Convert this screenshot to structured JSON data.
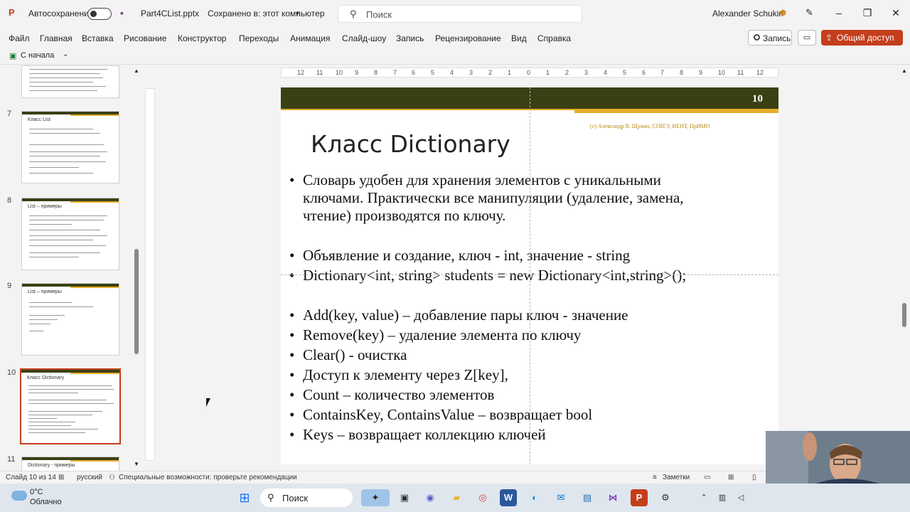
{
  "titlebar": {
    "autosave_label": "Автосохранение",
    "file_name": "Part4CList.pptx",
    "save_status": "Сохранено в: этот компьютер",
    "search_placeholder": "Поиск",
    "user_name": "Alexander Schukin"
  },
  "menu": {
    "items": [
      "Файл",
      "Главная",
      "Вставка",
      "Рисование",
      "Конструктор",
      "Переходы",
      "Анимация",
      "Слайд-шоу",
      "Запись",
      "Рецензирование",
      "Вид",
      "Справка"
    ],
    "record_label": "Запись",
    "share_label": "Общий доступ"
  },
  "quickbar": {
    "from_start_label": "С начала"
  },
  "thumbnails": [
    {
      "number": "7",
      "title": "Класс List"
    },
    {
      "number": "8",
      "title": "List – примеры"
    },
    {
      "number": "9",
      "title": "List – примеры"
    },
    {
      "number": "10",
      "title": "Класс Dictionary"
    },
    {
      "number": "11",
      "title": "Dictionary - примеры"
    }
  ],
  "ruler": {
    "ticks": [
      "12",
      "11",
      "10",
      "9",
      "8",
      "7",
      "6",
      "5",
      "4",
      "3",
      "2",
      "1",
      "0",
      "1",
      "2",
      "3",
      "4",
      "5",
      "6",
      "7",
      "8",
      "9",
      "10",
      "11",
      "12"
    ]
  },
  "slide": {
    "number": "10",
    "copyright": "(c) Александр В. Щукин, СПбГУ, ИЕНТ, ПрИМО",
    "title": "Класс Dictionary",
    "bullet_char": "•",
    "bullets": [
      [
        "Словарь удобен для хранения элементов с уникальными",
        "ключами. Практически все манипуляции (удаление, замена,",
        "чтение) производятся по ключу."
      ],
      "Объявление и создание, ключ - int, значение - string",
      "Dictionary<int, string> students = new Dictionary<int,string>();",
      "Add(key, value) – добавление пары ключ - значение",
      "Remove(key) – удаление элемента по ключу",
      "Clear() - очистка",
      "Доступ к элементу через Z[key],",
      "Count – количество элементов",
      "ContainsKey, ContainsValue – возвращает bool",
      "Keys – возвращает коллекцию ключей"
    ]
  },
  "statusbar": {
    "slide_info": "Слайд 10 из 14",
    "language": "русский",
    "accessibility": "Специальные возможности: проверьте рекомендации",
    "notes_label": "Заметки"
  },
  "taskbar": {
    "temperature": "0°C",
    "weather": "Облачно",
    "search_label": "Поиск"
  },
  "colors": {
    "accent": "#c43e1c",
    "slide_header": "#3a3f14",
    "slide_stripe": "#e5ad29"
  }
}
